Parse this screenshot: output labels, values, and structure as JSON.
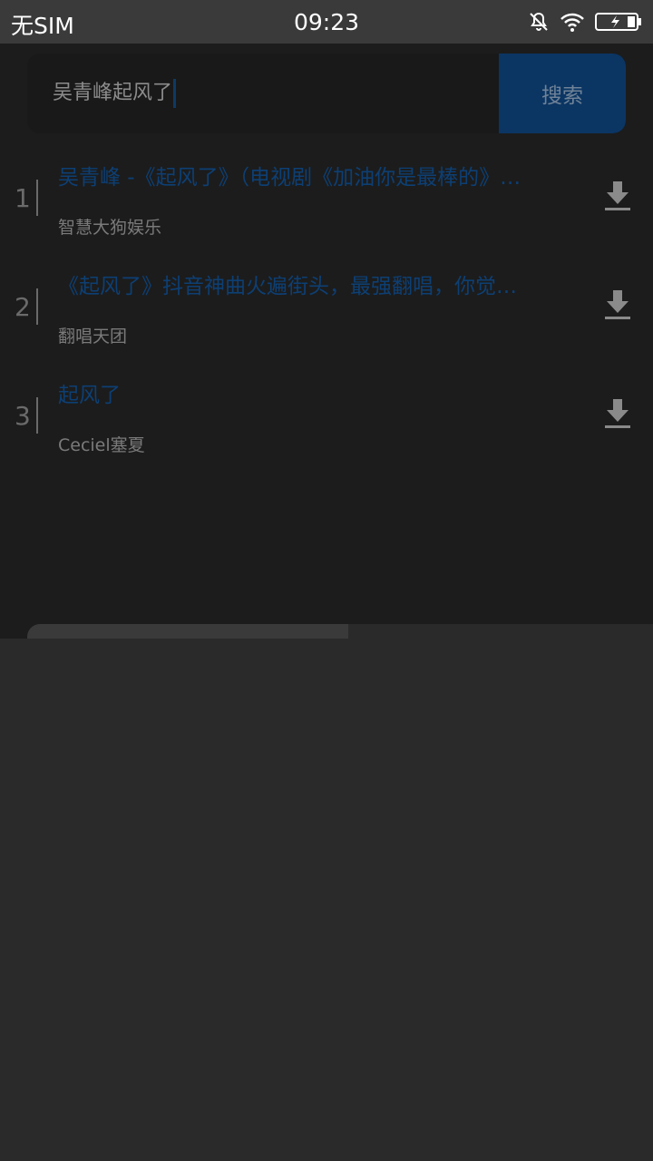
{
  "status_bar": {
    "carrier": "无SIM",
    "time": "09:23",
    "icons": [
      "bell-muted-icon",
      "wifi-icon",
      "battery-charging-icon"
    ]
  },
  "search": {
    "query": "吴青峰起风了",
    "button_label": "搜索"
  },
  "results": [
    {
      "index": "1",
      "title": "吴青峰 -《起风了》（电视剧《加油你是最棒的》…",
      "artist": "智慧大狗娱乐"
    },
    {
      "index": "2",
      "title": "《起风了》抖音神曲火遍街头，最强翻唱，你觉…",
      "artist": "翻唱天团"
    },
    {
      "index": "3",
      "title": "起风了",
      "artist": "Ceciel塞夏"
    }
  ],
  "colors": {
    "accent": "#0b3563",
    "title_link": "#0d3f74"
  }
}
